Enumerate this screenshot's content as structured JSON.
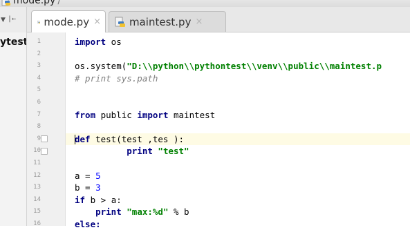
{
  "breadcrumb": {
    "file": "mode.py",
    "separator": "/"
  },
  "toolstrip": {
    "arrow_icon": "caret-down-icon",
    "collapse_icon": "collapse-icon"
  },
  "tabs": [
    {
      "label": "mode.py",
      "close": "×",
      "active": true
    },
    {
      "label": "maintest.py",
      "close": "×",
      "active": false
    }
  ],
  "project": {
    "root_label": "ytest"
  },
  "editor": {
    "line_numbers": [
      "1",
      "2",
      "3",
      "4",
      "5",
      "6",
      "7",
      "8",
      "9",
      "10",
      "11",
      "12",
      "13",
      "14",
      "15",
      "16"
    ],
    "lines": [
      [
        {
          "t": "import",
          "c": "kw"
        },
        {
          "t": " os",
          "c": ""
        }
      ],
      [],
      [
        {
          "t": "os.system(",
          "c": ""
        },
        {
          "t": "\"D:\\\\python\\\\pythontest\\\\venv\\\\public\\\\maintest.p",
          "c": "str"
        }
      ],
      [
        {
          "t": "# print sys.path",
          "c": "cmt"
        }
      ],
      [],
      [],
      [
        {
          "t": "from",
          "c": "kw"
        },
        {
          "t": " public ",
          "c": ""
        },
        {
          "t": "import",
          "c": "kw"
        },
        {
          "t": " maintest",
          "c": ""
        }
      ],
      [],
      [
        {
          "t": "def",
          "c": "kw"
        },
        {
          "t": " test(test ,tes ):",
          "c": ""
        }
      ],
      [
        {
          "t": "          print ",
          "c": "kw"
        },
        {
          "t": "\"test\"",
          "c": "str"
        }
      ],
      [],
      [
        {
          "t": "a = ",
          "c": ""
        },
        {
          "t": "5",
          "c": "num"
        }
      ],
      [
        {
          "t": "b = ",
          "c": ""
        },
        {
          "t": "3",
          "c": "num"
        }
      ],
      [
        {
          "t": "if",
          "c": "kw"
        },
        {
          "t": " b > a:",
          "c": ""
        }
      ],
      [
        {
          "t": "    print ",
          "c": "kw"
        },
        {
          "t": "\"max:%d\"",
          "c": "str"
        },
        {
          "t": " % b",
          "c": ""
        }
      ],
      [
        {
          "t": "else:",
          "c": "kw"
        }
      ]
    ]
  },
  "colors": {
    "keyword": "#000080",
    "string": "#008000",
    "comment": "#808080",
    "number": "#0000ff",
    "current_line": "#fefbe4"
  }
}
